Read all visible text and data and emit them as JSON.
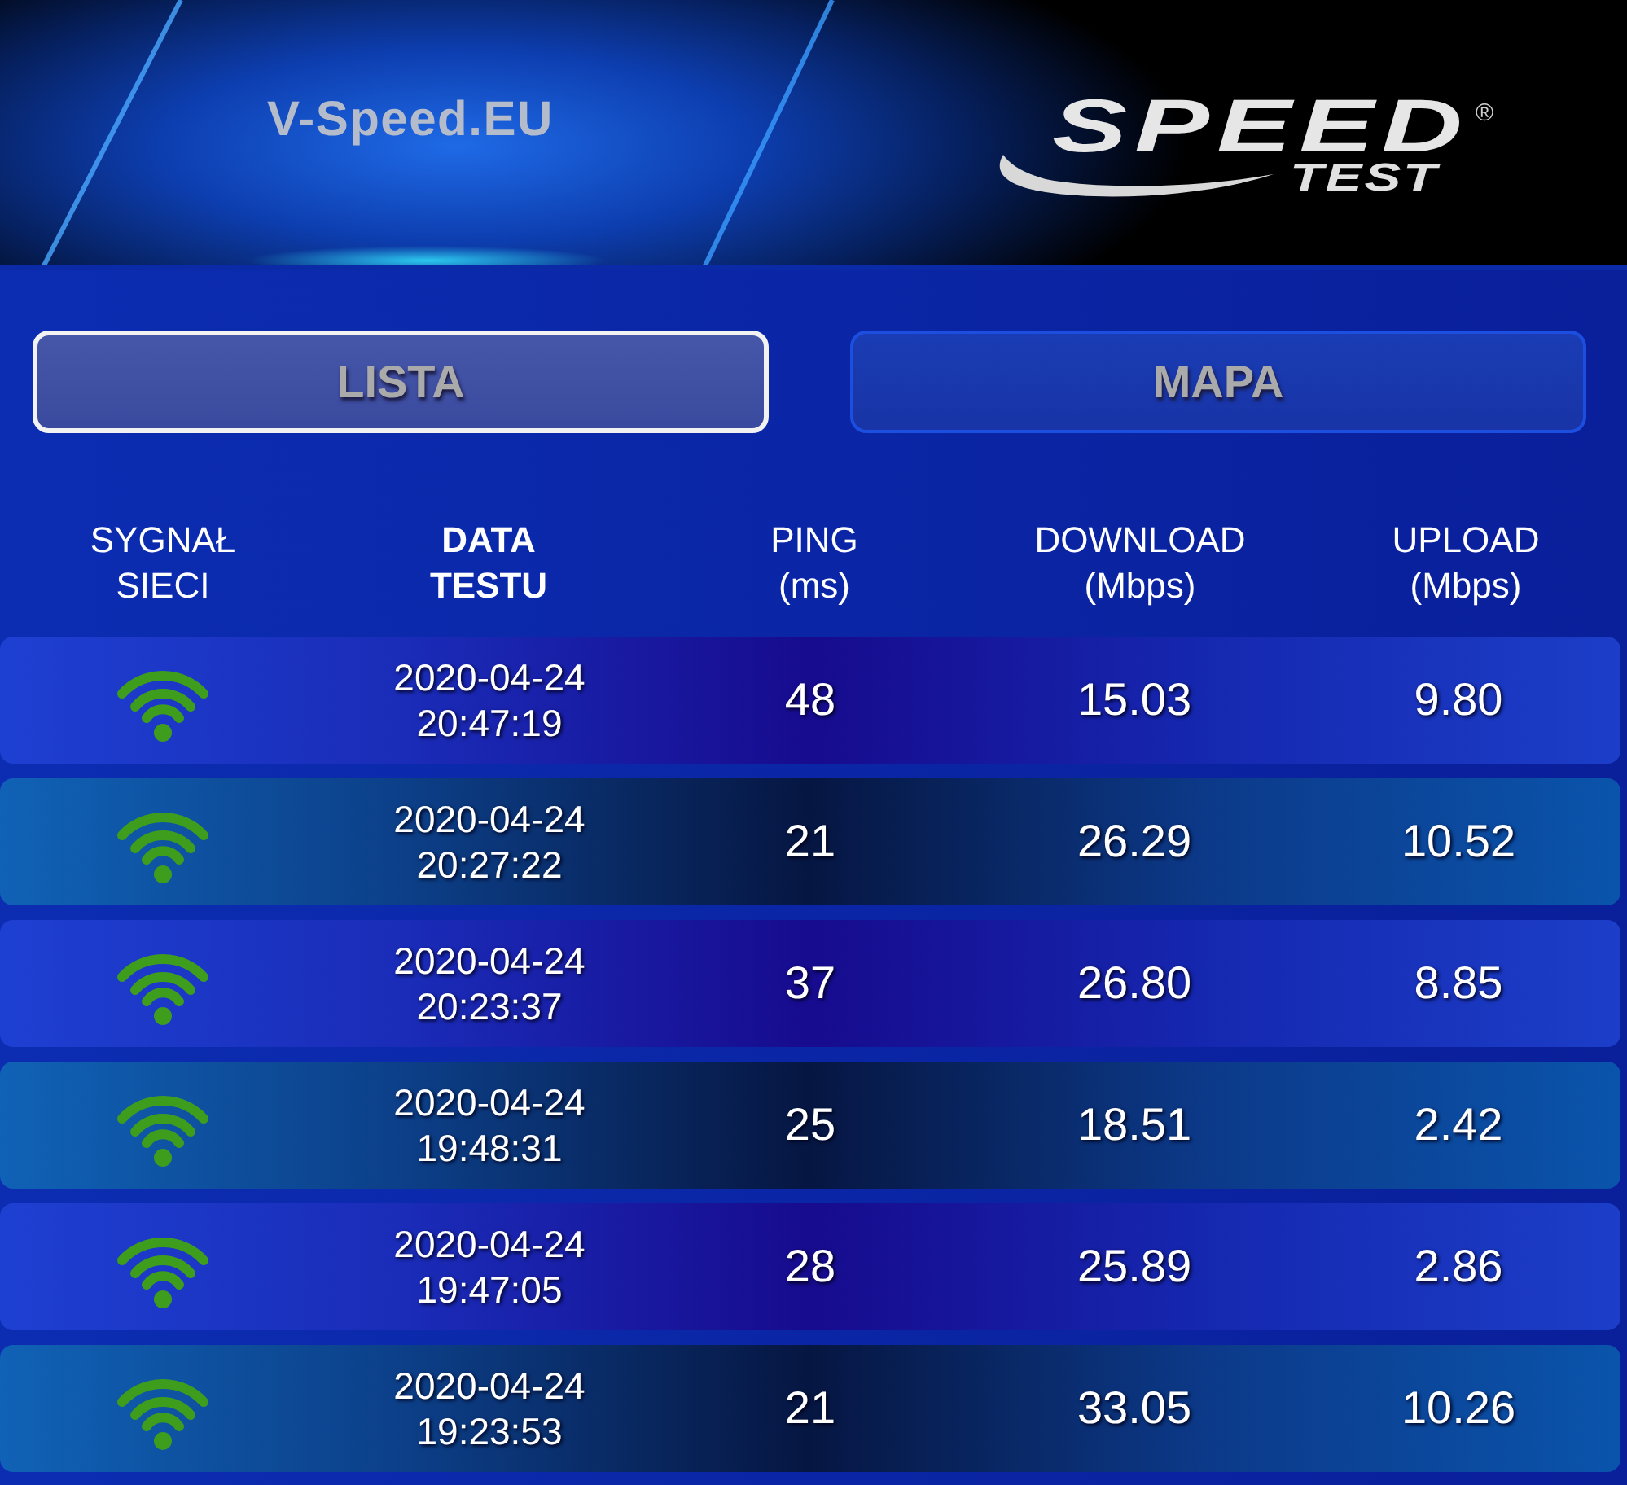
{
  "banner": {
    "brand": "V-Speed.EU",
    "logo_word": "SPEED",
    "logo_mark": "®",
    "logo_subword": "TEST"
  },
  "tabs": [
    {
      "label": "LISTA",
      "selected": true
    },
    {
      "label": "MAPA",
      "selected": false
    }
  ],
  "table": {
    "columns": [
      {
        "lines": [
          "SYGNAŁ",
          "SIECI"
        ],
        "sorted": false
      },
      {
        "lines": [
          "DATA",
          "TESTU"
        ],
        "sorted": true
      },
      {
        "lines": [
          "PING",
          "(ms)"
        ],
        "sorted": false
      },
      {
        "lines": [
          "DOWNLOAD",
          "(Mbps)"
        ],
        "sorted": false
      },
      {
        "lines": [
          "UPLOAD",
          "(Mbps)"
        ],
        "sorted": false
      }
    ],
    "rows": [
      {
        "date": "2020-04-24",
        "time": "20:47:19",
        "ping": "48",
        "download": "15.03",
        "upload": "9.80"
      },
      {
        "date": "2020-04-24",
        "time": "20:27:22",
        "ping": "21",
        "download": "26.29",
        "upload": "10.52"
      },
      {
        "date": "2020-04-24",
        "time": "20:23:37",
        "ping": "37",
        "download": "26.80",
        "upload": "8.85"
      },
      {
        "date": "2020-04-24",
        "time": "19:48:31",
        "ping": "25",
        "download": "18.51",
        "upload": "2.42"
      },
      {
        "date": "2020-04-24",
        "time": "19:47:05",
        "ping": "28",
        "download": "25.89",
        "upload": "2.86"
      },
      {
        "date": "2020-04-24",
        "time": "19:23:53",
        "ping": "21",
        "download": "33.05",
        "upload": "10.26"
      }
    ]
  }
}
